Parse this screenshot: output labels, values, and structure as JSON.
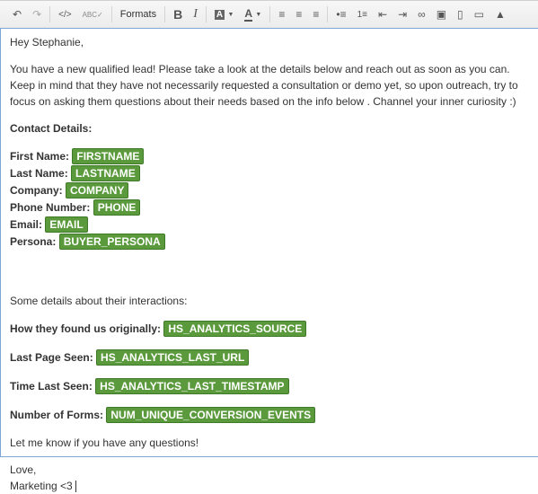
{
  "toolbar": {
    "formats_label": "Formats",
    "buttons": [
      "undo-icon",
      "redo-icon",
      "source-code-icon",
      "spellcheck-icon",
      "formats",
      "bold-icon",
      "italic-icon",
      "background-color-icon",
      "text-color-icon",
      "align-left-icon",
      "align-center-icon",
      "align-right-icon",
      "bullet-list-icon",
      "numbered-list-icon",
      "outdent-icon",
      "indent-icon",
      "link-icon",
      "image-icon",
      "document-icon",
      "cta-button-icon",
      "personalize-icon"
    ]
  },
  "email": {
    "greeting": "Hey Stephanie,",
    "intro": "You have a new qualified lead! Please take a look at the details below and reach out as soon as you can. Keep in mind that they have not necessarily requested a consultation or demo yet, so upon outreach, try to focus on asking them questions about their needs based on the info below . Channel your inner curiosity :)",
    "contact_heading": "Contact Details:",
    "contacts": [
      {
        "label": "First Name:",
        "token": "FIRSTNAME"
      },
      {
        "label": "Last Name:",
        "token": "LASTNAME"
      },
      {
        "label": "Company:",
        "token": "COMPANY"
      },
      {
        "label": "Phone Number:",
        "token": "PHONE"
      },
      {
        "label": "Email:",
        "token": "EMAIL"
      },
      {
        "label": "Persona:",
        "token": "BUYER_PERSONA"
      }
    ],
    "interactions_intro": "Some details about their interactions:",
    "interactions": [
      {
        "label": "How they found us originally:",
        "token": "HS_ANALYTICS_SOURCE"
      },
      {
        "label": "Last Page Seen:",
        "token": "HS_ANALYTICS_LAST_URL"
      },
      {
        "label": "Time Last Seen:",
        "token": "HS_ANALYTICS_LAST_TIMESTAMP"
      },
      {
        "label": "Number of Forms:",
        "token": "NUM_UNIQUE_CONVERSION_EVENTS"
      }
    ],
    "closing": "Let me know if you have any questions!",
    "signoff": "Love,",
    "signature": "Marketing <3"
  },
  "colors": {
    "token_bg": "#5a9a3c",
    "focus_border": "#7aa7d8"
  }
}
